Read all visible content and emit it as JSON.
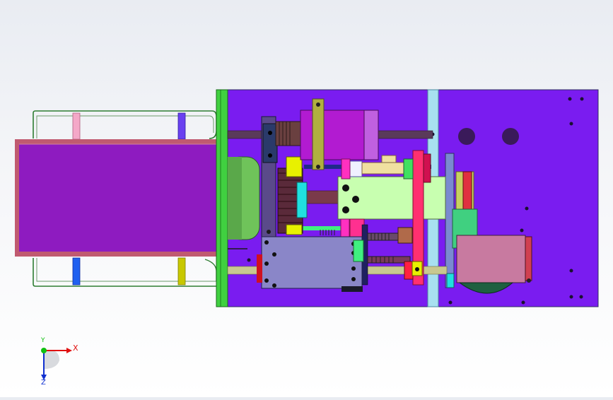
{
  "viewport": {
    "background": "#eef0f4",
    "colors": {
      "base_plate": "#7a1cf0",
      "side_plate": "#40d040",
      "tray": "#8e1bc0",
      "tray_border": "#c04060",
      "frame_rail": "#2e7d32",
      "rail_blue": "#a8e0f0",
      "motor_green": "#6fc35a",
      "motor_purple": "#b21bd1",
      "gear_dark": "#4a3a6a",
      "block_light_green": "#c8ffb0",
      "block_gray_blue": "#8a86c8",
      "stepper_pink": "#c87aa0",
      "rod": "#5a3a5a",
      "yellow": "#e8f000",
      "red": "#e81020",
      "magenta": "#ff30c0",
      "cyan": "#20e0e0",
      "olive": "#b0b040",
      "dark_green_disc": "#1e6040"
    }
  },
  "triad": {
    "x_label": "X",
    "y_label": "Y",
    "z_label": "Z",
    "x_color": "#e01010",
    "y_color": "#10c010",
    "z_color": "#1030d0"
  }
}
